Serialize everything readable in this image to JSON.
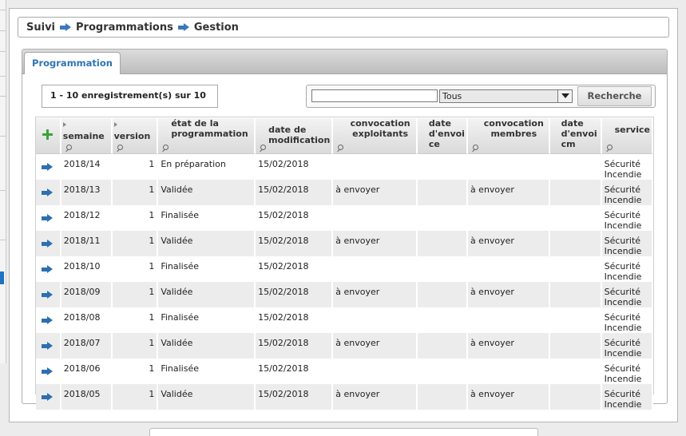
{
  "breadcrumb": [
    "Suivi",
    "Programmations",
    "Gestion"
  ],
  "tabs": [
    {
      "label": "Programmation",
      "active": true
    }
  ],
  "record_count": "1 - 10 enregistrement(s) sur 10",
  "search": {
    "value": "",
    "filter_selected": "Tous",
    "button_label": "Recherche"
  },
  "columns": [
    "semaine",
    "version",
    "état de la programmation",
    "date de modification",
    "convocation exploitants",
    "date d'envoice",
    "convocation membres",
    "date d'envoicm",
    "service"
  ],
  "rows": [
    {
      "semaine": "2018/14",
      "version": "1",
      "etat": "En préparation",
      "date_modif": "15/02/2018",
      "conv_exploitants": "",
      "date_envoi_ce": "",
      "conv_membres": "",
      "date_envoi_cm": "",
      "service": "Sécurité Incendie"
    },
    {
      "semaine": "2018/13",
      "version": "1",
      "etat": "Validée",
      "date_modif": "15/02/2018",
      "conv_exploitants": "à envoyer",
      "date_envoi_ce": "",
      "conv_membres": "à envoyer",
      "date_envoi_cm": "",
      "service": "Sécurité Incendie"
    },
    {
      "semaine": "2018/12",
      "version": "1",
      "etat": "Finalisée",
      "date_modif": "15/02/2018",
      "conv_exploitants": "",
      "date_envoi_ce": "",
      "conv_membres": "",
      "date_envoi_cm": "",
      "service": "Sécurité Incendie"
    },
    {
      "semaine": "2018/11",
      "version": "1",
      "etat": "Validée",
      "date_modif": "15/02/2018",
      "conv_exploitants": "à envoyer",
      "date_envoi_ce": "",
      "conv_membres": "à envoyer",
      "date_envoi_cm": "",
      "service": "Sécurité Incendie"
    },
    {
      "semaine": "2018/10",
      "version": "1",
      "etat": "Finalisée",
      "date_modif": "15/02/2018",
      "conv_exploitants": "",
      "date_envoi_ce": "",
      "conv_membres": "",
      "date_envoi_cm": "",
      "service": "Sécurité Incendie"
    },
    {
      "semaine": "2018/09",
      "version": "1",
      "etat": "Validée",
      "date_modif": "15/02/2018",
      "conv_exploitants": "à envoyer",
      "date_envoi_ce": "",
      "conv_membres": "à envoyer",
      "date_envoi_cm": "",
      "service": "Sécurité Incendie"
    },
    {
      "semaine": "2018/08",
      "version": "1",
      "etat": "Finalisée",
      "date_modif": "15/02/2018",
      "conv_exploitants": "",
      "date_envoi_ce": "",
      "conv_membres": "",
      "date_envoi_cm": "",
      "service": "Sécurité Incendie"
    },
    {
      "semaine": "2018/07",
      "version": "1",
      "etat": "Validée",
      "date_modif": "15/02/2018",
      "conv_exploitants": "à envoyer",
      "date_envoi_ce": "",
      "conv_membres": "à envoyer",
      "date_envoi_cm": "",
      "service": "Sécurité Incendie"
    },
    {
      "semaine": "2018/06",
      "version": "1",
      "etat": "Finalisée",
      "date_modif": "15/02/2018",
      "conv_exploitants": "",
      "date_envoi_ce": "",
      "conv_membres": "",
      "date_envoi_cm": "",
      "service": "Sécurité Incendie"
    },
    {
      "semaine": "2018/05",
      "version": "1",
      "etat": "Validée",
      "date_modif": "15/02/2018",
      "conv_exploitants": "à envoyer",
      "date_envoi_ce": "",
      "conv_membres": "à envoyer",
      "date_envoi_cm": "",
      "service": "Sécurité Incendie"
    }
  ],
  "icons": {
    "add": "plus-icon",
    "row_action": "arrow-right-icon",
    "sort": "sort-triangle-icon",
    "filter": "magnifier-icon",
    "breadcrumb_sep": "arrow-right-icon"
  },
  "colors": {
    "accent": "#2e74b5",
    "add": "#3aa33a",
    "arrow": "#2d6fb0",
    "row_alt": "#ececec"
  }
}
